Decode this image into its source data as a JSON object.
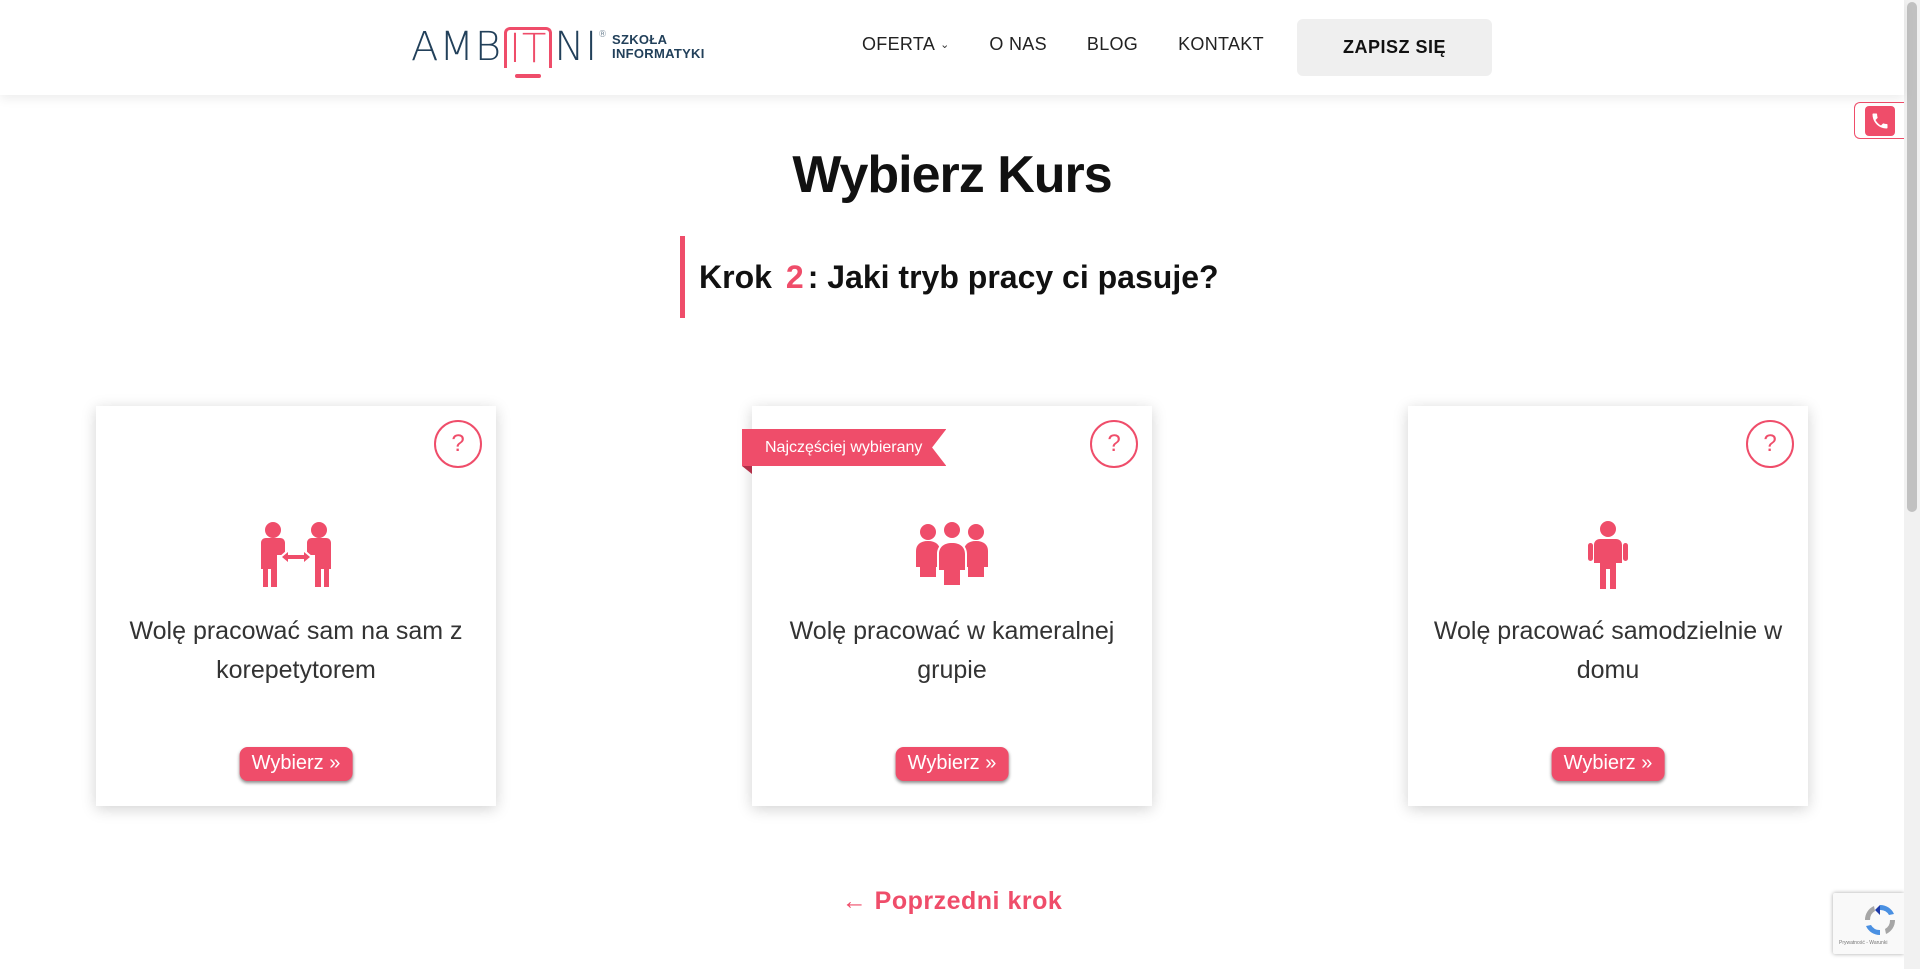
{
  "header": {
    "logo": {
      "word_left": "AMB",
      "word_it": "IT",
      "word_right": "NI",
      "reg": "®",
      "sub_line1": "SZKOŁA",
      "sub_line2": "INFORMATYKI"
    },
    "nav": [
      {
        "label": "OFERTA",
        "has_dropdown": true
      },
      {
        "label": "O NAS"
      },
      {
        "label": "BLOG"
      },
      {
        "label": "KONTAKT"
      }
    ],
    "cta_label": "ZAPISZ SIĘ"
  },
  "main": {
    "title": "Wybierz Kurs",
    "step": {
      "prefix": "Krok",
      "number": "2",
      "question": ": Jaki tryb pracy ci pasuje?"
    },
    "cards": [
      {
        "icon": "one-on-one-icon",
        "text": "Wolę pracować sam na sam z korepetytorem",
        "button": "Wybierz »",
        "help": "?"
      },
      {
        "icon": "group-icon",
        "text": "Wolę pracować w kameralnej grupie",
        "button": "Wybierz »",
        "help": "?",
        "ribbon": "Najczęściej wybierany"
      },
      {
        "icon": "person-icon",
        "text": "Wolę pracować samodzielnie w domu",
        "button": "Wybierz »",
        "help": "?"
      }
    ],
    "prev_step": "← Poprzedni krok"
  },
  "colors": {
    "accent": "#ef4d6a",
    "logo_dark": "#22405a",
    "cta_bg": "#efefef"
  },
  "recaptcha": {
    "text": "Prywatność - Warunki"
  }
}
